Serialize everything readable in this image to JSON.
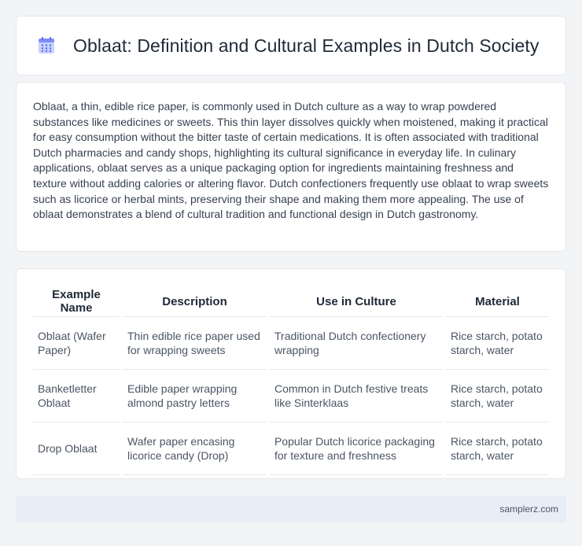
{
  "header": {
    "icon": "calendar-icon",
    "title": "Oblaat: Definition and Cultural Examples in Dutch Society"
  },
  "intro": {
    "text": "Oblaat, a thin, edible rice paper, is commonly used in Dutch culture as a way to wrap powdered substances like medicines or sweets. This thin layer dissolves quickly when moistened, making it practical for easy consumption without the bitter taste of certain medications. It is often associated with traditional Dutch pharmacies and candy shops, highlighting its cultural significance in everyday life. In culinary applications, oblaat serves as a unique packaging option for ingredients maintaining freshness and texture without adding calories or altering flavor. Dutch confectioners frequently use oblaat to wrap sweets such as licorice or herbal mints, preserving their shape and making them more appealing. The use of oblaat demonstrates a blend of cultural tradition and functional design in Dutch gastronomy."
  },
  "table": {
    "headers": [
      "Example Name",
      "Description",
      "Use in Culture",
      "Material"
    ],
    "rows": [
      [
        "Oblaat (Wafer Paper)",
        "Thin edible rice paper used for wrapping sweets",
        "Traditional Dutch confectionery wrapping",
        "Rice starch, potato starch, water"
      ],
      [
        "Banketletter Oblaat",
        "Edible paper wrapping almond pastry letters",
        "Common in Dutch festive treats like Sinterklaas",
        "Rice starch, potato starch, water"
      ],
      [
        "Drop Oblaat",
        "Wafer paper encasing licorice candy (Drop)",
        "Popular Dutch licorice packaging for texture and freshness",
        "Rice starch, potato starch, water"
      ]
    ]
  },
  "footer": {
    "site": "samplerz.com"
  }
}
